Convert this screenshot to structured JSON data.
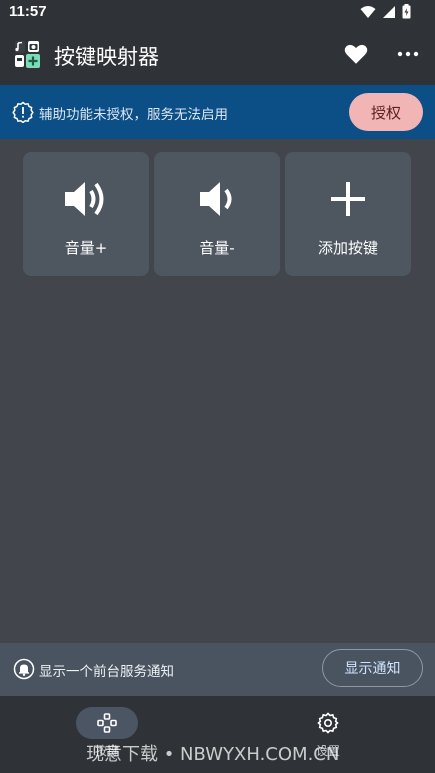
{
  "status_bar": {
    "time": "11:57",
    "icons": [
      "wifi-icon",
      "signal-icon",
      "battery-icon"
    ]
  },
  "app_bar": {
    "title": "按键映射器",
    "logo": "app-logo-icon",
    "actions": [
      "heart-icon",
      "more-icon"
    ]
  },
  "banner": {
    "message": "辅助功能未授权，服务无法启用",
    "button_label": "授权",
    "icon": "warning-gear-icon"
  },
  "keys": [
    {
      "label": "音量+",
      "icon": "volume-up-icon"
    },
    {
      "label": "音量-",
      "icon": "volume-down-icon"
    },
    {
      "label": "添加按键",
      "icon": "plus-icon"
    }
  ],
  "notice": {
    "message": "显示一个前台服务通知",
    "button_label": "显示通知",
    "icon": "bell-icon"
  },
  "bottom_nav": {
    "items": [
      {
        "label": "按键",
        "icon": "gamepad-icon",
        "active": true
      },
      {
        "label": "设置",
        "icon": "gear-icon",
        "active": false
      }
    ]
  },
  "watermark": "现意下载 • NBWYXH.COM.CN",
  "colors": {
    "background": "#42464c",
    "app_bar": "#2f3236",
    "banner": "#0c4f86",
    "auth_button": "#f1b5b5",
    "key_card": "#4e5660",
    "notice_bar": "#4a5460"
  }
}
